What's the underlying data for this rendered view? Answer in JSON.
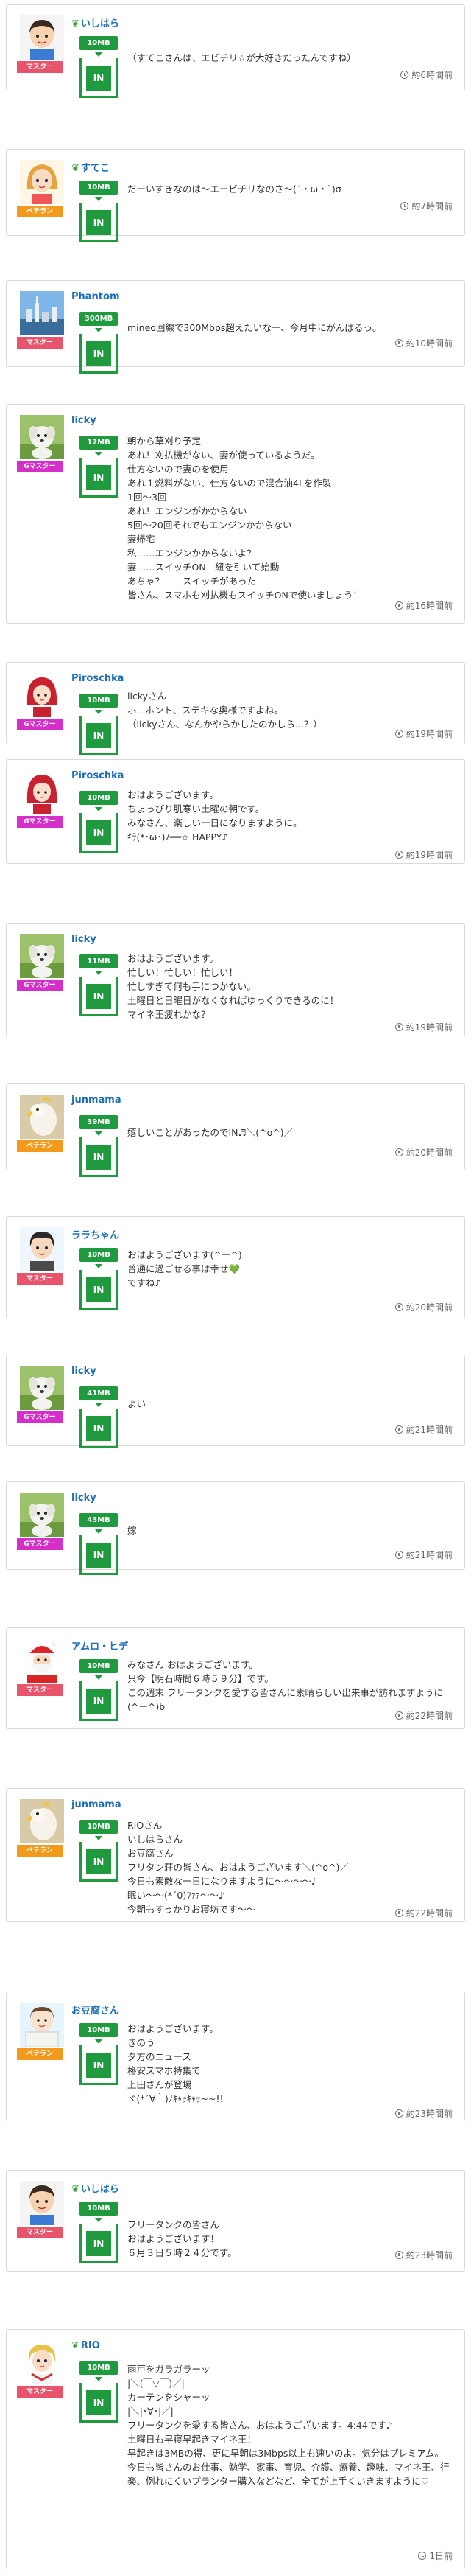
{
  "colors": {
    "master_rank": "#e8546b",
    "veteran_rank": "#f39a1c",
    "gmaster_rank": "#d52ec9",
    "tank_green": "#1f9a3e",
    "name_blue": "#1e6fb8"
  },
  "tank_in_label": "IN",
  "posts": [
    {
      "user": "いしはら",
      "leaf": true,
      "rank": "マスター",
      "rank_type": "master",
      "avatar": "boy",
      "mb": "10MB",
      "message": [
        "（すてこさんは、エビチリ☆が大好きだったんですね）"
      ],
      "time": "約6時間前"
    },
    {
      "user": "すてこ",
      "leaf": true,
      "rank": "ベテラン",
      "rank_type": "veteran",
      "avatar": "girl",
      "mb": "10MB",
      "message": [
        "だーいすきなのは〜エービチリなのさ〜(´・ω・`)σ"
      ],
      "time": "約7時間前"
    },
    {
      "user": "Phantom",
      "leaf": false,
      "rank": "マスター",
      "rank_type": "master",
      "avatar": "city",
      "mb": "300MB",
      "message": [
        "mineo回線で300Mbps超えたいなー、今月中にがんばるっ。"
      ],
      "time": "約10時間前"
    },
    {
      "user": "licky",
      "leaf": false,
      "rank": "Gマスター",
      "rank_type": "gmaster",
      "avatar": "dog",
      "mb": "12MB",
      "message": [
        "朝から草刈り予定",
        "あれ！刈払機がない、妻が使っているようだ。",
        "仕方ないので妻のを使用",
        "あれ１燃料がない、仕方ないので混合油4Lを作製",
        "1回〜3回",
        "あれ！エンジンがかからない",
        "5回〜20回それでもエンジンかからない",
        "妻帰宅",
        "私……エンジンかからないよ？",
        "妻……スイッチON　紐を引いて始動",
        "あちゃ？　　スイッチがあった",
        "皆さん、スマホも刈払機もスイッチONで使いましょう！"
      ],
      "time": "約16時間前"
    },
    {
      "user": "Piroschka",
      "leaf": false,
      "rank": "Gマスター",
      "rank_type": "gmaster",
      "avatar": "red",
      "mb": "10MB",
      "message": [
        "lickyさん",
        "ホ...ホント、ステキな奥様ですよね。",
        "（lickyさん、なんかやらかしたのかしら...？）"
      ],
      "time": "約19時間前"
    },
    {
      "user": "Piroschka",
      "leaf": false,
      "rank": "Gマスター",
      "rank_type": "gmaster",
      "avatar": "red",
      "mb": "10MB",
      "message": [
        "おはようございます。",
        "ちょっぴり肌寒い土曜の朝です。",
        "みなさん、楽しい一日になりますように。",
        "ｷﾗ(*･ω･)ﾉ━━☆ HAPPY♪"
      ],
      "time": "約19時間前"
    },
    {
      "user": "licky",
      "leaf": false,
      "rank": "Gマスター",
      "rank_type": "gmaster",
      "avatar": "dog",
      "mb": "11MB",
      "message": [
        "おはようございます。",
        "忙しい！忙しい！忙しい！",
        "忙しすぎて何も手につかない。",
        "土曜日と日曜日がなくなればゆっくりできるのに！",
        "マイネ王疲れかな？"
      ],
      "time": "約19時間前"
    },
    {
      "user": "junmama",
      "leaf": false,
      "rank": "ベテラン",
      "rank_type": "veteran",
      "avatar": "parrot",
      "mb": "39MB",
      "message": [
        "嬉しいことがあったのでIN♬＼(^o^)／"
      ],
      "time": "約20時間前"
    },
    {
      "user": "ララちゃん",
      "leaf": false,
      "rank": "マスター",
      "rank_type": "master",
      "avatar": "boy2",
      "mb": "10MB",
      "message": [
        "おはようございます(^ー^)",
        "普通に過ごせる事は幸せ💚",
        "ですね♪"
      ],
      "time": "約20時間前"
    },
    {
      "user": "licky",
      "leaf": false,
      "rank": "Gマスター",
      "rank_type": "gmaster",
      "avatar": "dog",
      "mb": "41MB",
      "message": [
        "よい"
      ],
      "time": "約21時間前"
    },
    {
      "user": "licky",
      "leaf": false,
      "rank": "Gマスター",
      "rank_type": "gmaster",
      "avatar": "dog",
      "mb": "43MB",
      "message": [
        "嫁"
      ],
      "time": "約21時間前"
    },
    {
      "user": "アムロ・ヒデ",
      "leaf": false,
      "rank": "マスター",
      "rank_type": "master",
      "avatar": "santa",
      "mb": "10MB",
      "message": [
        "みなさん おはようございます。",
        "只今【明石時間６時５９分】です。",
        "この週末 フリータンクを愛する皆さんに素晴らしい出来事が訪れますように (^ー^)b"
      ],
      "time": "約22時間前"
    },
    {
      "user": "junmama",
      "leaf": false,
      "rank": "ベテラン",
      "rank_type": "veteran",
      "avatar": "parrot",
      "mb": "10MB",
      "message": [
        "RIOさん",
        "いしはらさん",
        "お豆腐さん",
        "フリタン荘の皆さん、おはようございます＼(^o^)／",
        "今日も素敵な一日になりますように〜〜〜〜♪",
        "眠い〜〜(*´0)ﾌｧｧ〜〜♪",
        "今朝もすっかりお寝坊です〜〜"
      ],
      "time": "約22時間前"
    },
    {
      "user": "お豆腐さん",
      "leaf": false,
      "rank": "ベテラン",
      "rank_type": "veteran",
      "avatar": "tofu",
      "mb": "10MB",
      "message": [
        "おはようございます。",
        "きのう",
        "夕方のニュース",
        "格安スマホ特集で",
        "上田さんが登場",
        "ヾ(*´∀｀)ﾉｷｬｯｷｬｯ~~!!"
      ],
      "time": "約23時間前"
    },
    {
      "user": "いしはら",
      "leaf": true,
      "rank": "マスター",
      "rank_type": "master",
      "avatar": "boy",
      "mb": "10MB",
      "message": [
        "フリータンクの皆さん",
        "おはようございます！",
        "６月３日５時２４分です。"
      ],
      "time": "約23時間前"
    },
    {
      "user": "RIO",
      "leaf": true,
      "rank": "マスター",
      "rank_type": "master",
      "avatar": "blond",
      "mb": "10MB",
      "message": [
        "雨戸をガラガラーッ",
        "|＼(￣▽￣)／|",
        "カーテンをシャーッ",
        "|＼|･∀･|／|",
        "フリータンクを愛する皆さん、おはようございます。4:44です♪",
        "土曜日も早寝早起きマイネ王！",
        "早起きは3MBの得、更に早朝は3Mbps以上も速いのよ。気分はプレミアム。",
        "今日も皆さんのお仕事、勉学、家事、育児、介護、療養、趣味、マイネ王、行楽、例れにくいプランター購入などなど、全てが上手くいきますように♡"
      ],
      "time": "1日前"
    }
  ]
}
